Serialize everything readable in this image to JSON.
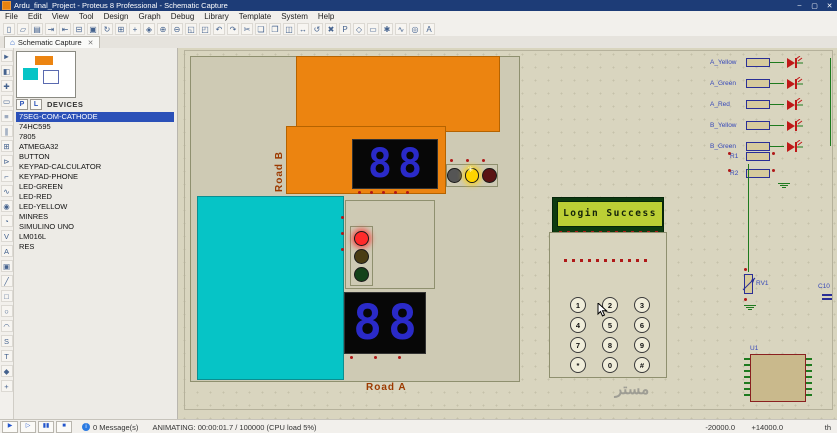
{
  "window": {
    "title": "Ardu_final_Project - Proteus 8 Professional - Schematic Capture",
    "minimize": "–",
    "maximize": "▢",
    "close": "✕"
  },
  "menu": {
    "items": [
      "File",
      "Edit",
      "View",
      "Tool",
      "Design",
      "Graph",
      "Debug",
      "Library",
      "Template",
      "System",
      "Help"
    ]
  },
  "toolbar": {
    "icons": [
      {
        "name": "new-project-icon",
        "g": "▯"
      },
      {
        "name": "open-project-icon",
        "g": "▱"
      },
      {
        "name": "save-project-icon",
        "g": "▤"
      },
      {
        "name": "import-icon",
        "g": "⇥"
      },
      {
        "name": "export-icon",
        "g": "⇤"
      },
      {
        "name": "print-icon",
        "g": "⊟"
      },
      {
        "name": "mark-area-icon",
        "g": "▣"
      },
      {
        "name": "redraw-icon",
        "g": "↻"
      },
      {
        "name": "grid-toggle-icon",
        "g": "⊞"
      },
      {
        "name": "origin-icon",
        "g": "+"
      },
      {
        "name": "pan-icon",
        "g": "◈"
      },
      {
        "name": "zoom-in-icon",
        "g": "⊕"
      },
      {
        "name": "zoom-out-icon",
        "g": "⊖"
      },
      {
        "name": "zoom-extents-icon",
        "g": "◱"
      },
      {
        "name": "zoom-area-icon",
        "g": "◰"
      },
      {
        "name": "undo-icon",
        "g": "↶"
      },
      {
        "name": "redo-icon",
        "g": "↷"
      },
      {
        "name": "cut-icon",
        "g": "✂"
      },
      {
        "name": "copy-icon",
        "g": "❏"
      },
      {
        "name": "paste-icon",
        "g": "❐"
      },
      {
        "name": "block-copy-icon",
        "g": "◫"
      },
      {
        "name": "block-move-icon",
        "g": "↔"
      },
      {
        "name": "block-rotate-icon",
        "g": "↺"
      },
      {
        "name": "block-delete-icon",
        "g": "✖"
      },
      {
        "name": "pick-parts-icon",
        "g": "P"
      },
      {
        "name": "make-device-icon",
        "g": "◇"
      },
      {
        "name": "packaging-tool-icon",
        "g": "▭"
      },
      {
        "name": "decompose-icon",
        "g": "✱"
      },
      {
        "name": "wire-autorouter-icon",
        "g": "∿"
      },
      {
        "name": "search-tag-icon",
        "g": "◎"
      },
      {
        "name": "property-assignment-icon",
        "g": "A"
      }
    ]
  },
  "tabbar": {
    "home_icon": "⌂",
    "tab_label": "Schematic Capture",
    "close_icon": "✕"
  },
  "left_toolbar": {
    "icons": [
      {
        "name": "selection-mode-icon",
        "g": "►"
      },
      {
        "name": "component-mode-icon",
        "g": "◧"
      },
      {
        "name": "junction-dot-icon",
        "g": "✚"
      },
      {
        "name": "wire-label-icon",
        "g": "▭"
      },
      {
        "name": "text-script-icon",
        "g": "≡"
      },
      {
        "name": "bus-mode-icon",
        "g": "∥"
      },
      {
        "name": "subcircuit-icon",
        "g": "⊞"
      },
      {
        "name": "terminal-mode-icon",
        "g": "⊳"
      },
      {
        "name": "device-pin-icon",
        "g": "⌐"
      },
      {
        "name": "graph-mode-icon",
        "g": "∿"
      },
      {
        "name": "tape-recorder-icon",
        "g": "◉"
      },
      {
        "name": "generator-mode-icon",
        "g": "◔"
      },
      {
        "name": "voltage-probe-icon",
        "g": "V"
      },
      {
        "name": "current-probe-icon",
        "g": "A"
      },
      {
        "name": "instruments-icon",
        "g": "▣"
      },
      {
        "name": "line-2d-icon",
        "g": "╱"
      },
      {
        "name": "box-2d-icon",
        "g": "□"
      },
      {
        "name": "circle-2d-icon",
        "g": "○"
      },
      {
        "name": "arc-2d-icon",
        "g": "◠"
      },
      {
        "name": "path-2d-icon",
        "g": "S"
      },
      {
        "name": "text-2d-icon",
        "g": "T"
      },
      {
        "name": "symbol-2d-icon",
        "g": "◆"
      },
      {
        "name": "marker-2d-icon",
        "g": "+"
      }
    ]
  },
  "panel": {
    "p": "P",
    "l": "L",
    "title": "DEVICES",
    "selected_index": 0,
    "devices": [
      "7SEG-COM-CATHODE",
      "74HC595",
      "7805",
      "ATMEGA32",
      "BUTTON",
      "KEYPAD-CALCULATOR",
      "KEYPAD-PHONE",
      "LED-GREEN",
      "LED-RED",
      "LED-YELLOW",
      "MINRES",
      "SIMULINO UNO",
      "LM016L",
      "RES"
    ]
  },
  "schematic": {
    "road_a": "Road A",
    "road_b": "Road B",
    "sparkle": "✳",
    "display_b_digits": [
      "8",
      "8"
    ],
    "display_a_digits": [
      "8",
      "8"
    ],
    "lcd_text": "Login Success",
    "keypad_keys": [
      "1",
      "2",
      "3",
      "4",
      "5",
      "6",
      "7",
      "8",
      "9",
      "*",
      "0",
      "#"
    ],
    "led_rows": [
      {
        "label": "A_Yellow"
      },
      {
        "label": "A_Green"
      },
      {
        "label": "A_Red"
      },
      {
        "label": "B_Yellow"
      },
      {
        "label": "B_Green"
      }
    ],
    "resistors": [
      {
        "label": "R1"
      },
      {
        "label": "R2"
      }
    ],
    "pot_label": "RV1",
    "cap_label": "C10",
    "ic_label": "U1",
    "watermark": "مستر"
  },
  "status": {
    "play": "▶",
    "step": "▷",
    "pause": "▮▮",
    "stop": "■",
    "message_icon": "i",
    "messages": "0 Message(s)",
    "animating": "ANIMATING: 00:00:01.7 / 100000 (CPU load 5%)",
    "coord_x": "-20000.0",
    "coord_y": "+14000.0",
    "units": "th"
  }
}
